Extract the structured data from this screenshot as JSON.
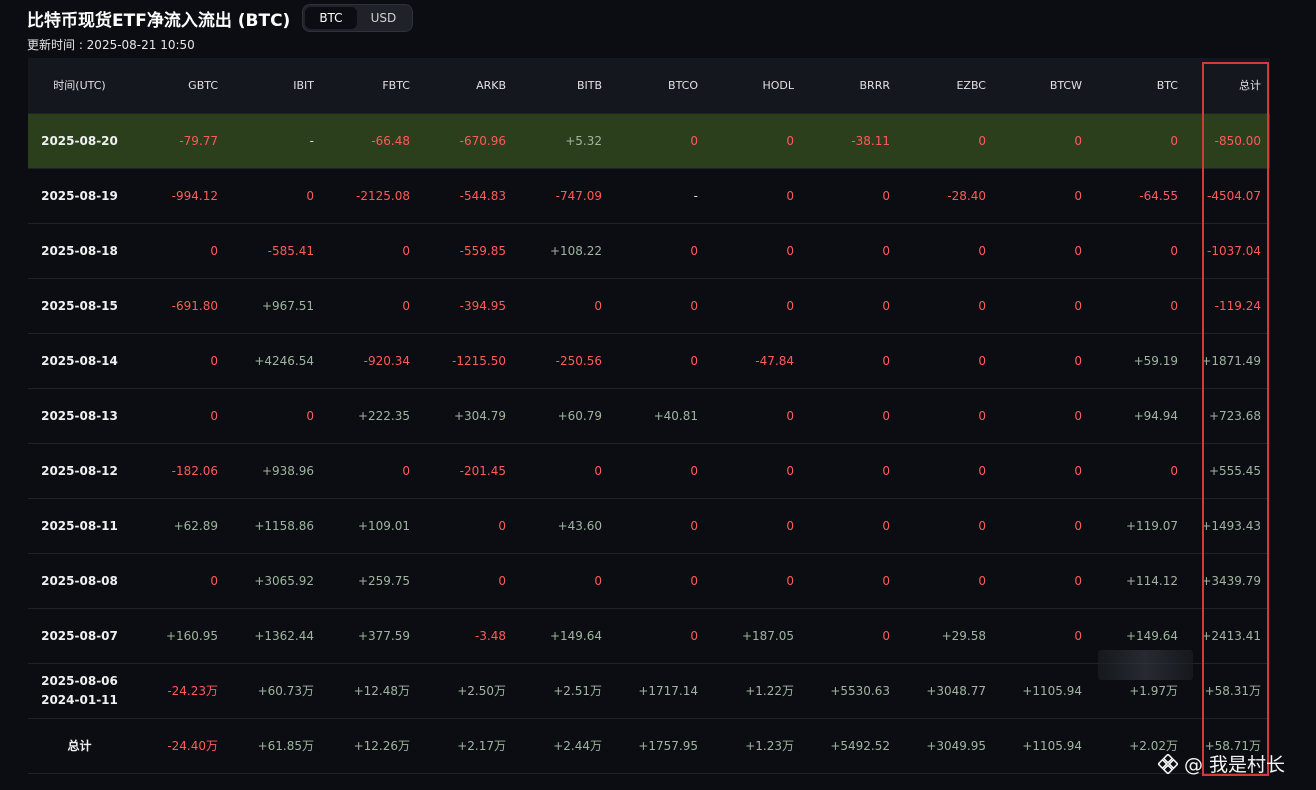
{
  "header": {
    "title": "比特币现货ETF净流入流出 (BTC)",
    "toggle": [
      {
        "label": "BTC",
        "active": true
      },
      {
        "label": "USD",
        "active": false
      }
    ],
    "updated": "更新时间 : 2025-08-21 10:50"
  },
  "colors": {
    "negative": "#ff5a5a",
    "positive": "#9fb59f",
    "highlight_row": "#2b3f1d",
    "box": "#d43a3a"
  },
  "table": {
    "columns": [
      "时间(UTC)",
      "GBTC",
      "IBIT",
      "FBTC",
      "ARKB",
      "BITB",
      "BTCO",
      "HODL",
      "BRRR",
      "EZBC",
      "BTCW",
      "BTC",
      "总计"
    ],
    "rows": [
      {
        "date": "2025-08-20",
        "values": [
          "-79.77",
          "-",
          "-66.48",
          "-670.96",
          "+5.32",
          "0",
          "0",
          "-38.11",
          "0",
          "0",
          "0",
          "-850.00"
        ]
      },
      {
        "date": "2025-08-19",
        "values": [
          "-994.12",
          "0",
          "-2125.08",
          "-544.83",
          "-747.09",
          "-",
          "0",
          "0",
          "-28.40",
          "0",
          "-64.55",
          "-4504.07"
        ]
      },
      {
        "date": "2025-08-18",
        "values": [
          "0",
          "-585.41",
          "0",
          "-559.85",
          "+108.22",
          "0",
          "0",
          "0",
          "0",
          "0",
          "0",
          "-1037.04"
        ]
      },
      {
        "date": "2025-08-15",
        "values": [
          "-691.80",
          "+967.51",
          "0",
          "-394.95",
          "0",
          "0",
          "0",
          "0",
          "0",
          "0",
          "0",
          "-119.24"
        ]
      },
      {
        "date": "2025-08-14",
        "values": [
          "0",
          "+4246.54",
          "-920.34",
          "-1215.50",
          "-250.56",
          "0",
          "-47.84",
          "0",
          "0",
          "0",
          "+59.19",
          "+1871.49"
        ]
      },
      {
        "date": "2025-08-13",
        "values": [
          "0",
          "0",
          "+222.35",
          "+304.79",
          "+60.79",
          "+40.81",
          "0",
          "0",
          "0",
          "0",
          "+94.94",
          "+723.68"
        ]
      },
      {
        "date": "2025-08-12",
        "values": [
          "-182.06",
          "+938.96",
          "0",
          "-201.45",
          "0",
          "0",
          "0",
          "0",
          "0",
          "0",
          "0",
          "+555.45"
        ]
      },
      {
        "date": "2025-08-11",
        "values": [
          "+62.89",
          "+1158.86",
          "+109.01",
          "0",
          "+43.60",
          "0",
          "0",
          "0",
          "0",
          "0",
          "+119.07",
          "+1493.43"
        ]
      },
      {
        "date": "2025-08-08",
        "values": [
          "0",
          "+3065.92",
          "+259.75",
          "0",
          "0",
          "0",
          "0",
          "0",
          "0",
          "0",
          "+114.12",
          "+3439.79"
        ]
      },
      {
        "date": "2025-08-07",
        "values": [
          "+160.95",
          "+1362.44",
          "+377.59",
          "-3.48",
          "+149.64",
          "0",
          "+187.05",
          "0",
          "+29.58",
          "0",
          "+149.64",
          "+2413.41"
        ]
      },
      {
        "date": "2025-08-06",
        "date2": "2024-01-11",
        "values": [
          "-24.23万",
          "+60.73万",
          "+12.48万",
          "+2.50万",
          "+2.51万",
          "+1717.14",
          "+1.22万",
          "+5530.63",
          "+3048.77",
          "+1105.94",
          "+1.97万",
          "+58.31万"
        ]
      },
      {
        "date": "总计",
        "values": [
          "-24.40万",
          "+61.85万",
          "+12.26万",
          "+2.17万",
          "+2.44万",
          "+1757.95",
          "+1.23万",
          "+5492.52",
          "+3049.95",
          "+1105.94",
          "+2.02万",
          "+58.71万"
        ]
      }
    ]
  },
  "watermark": {
    "text": "@ 我是村长",
    "icon": "binance-logo-icon"
  }
}
